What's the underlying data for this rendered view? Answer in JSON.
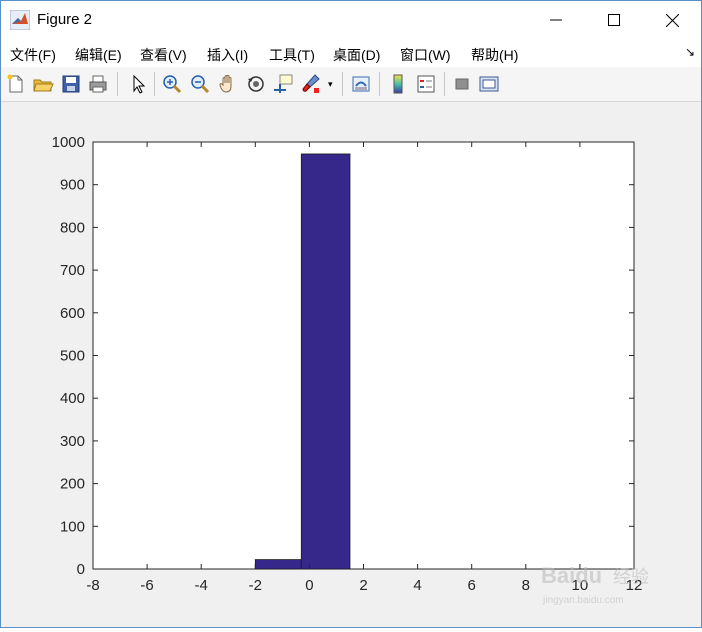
{
  "window": {
    "title": "Figure 2"
  },
  "menu": {
    "items": [
      "文件(F)",
      "编辑(E)",
      "查看(V)",
      "插入(I)",
      "工具(T)",
      "桌面(D)",
      "窗口(W)",
      "帮助(H)"
    ]
  },
  "toolbar": {
    "icons": [
      "new-figure-icon",
      "open-file-icon",
      "save-icon",
      "print-icon",
      "pointer-icon",
      "zoom-in-icon",
      "zoom-out-icon",
      "pan-icon",
      "rotate-3d-icon",
      "data-cursor-icon",
      "brush-icon",
      "link-plot-icon",
      "colorbar-icon",
      "legend-icon",
      "hide-plot-tools-icon",
      "show-plot-tools-icon"
    ]
  },
  "colors": {
    "bar": "#35288a",
    "axes_bg": "#ffffff",
    "figure_bg": "#f0f0f0"
  },
  "chart_data": {
    "type": "bar",
    "bins": [
      {
        "x_start": -2,
        "x_end": -0.3,
        "value": 22
      },
      {
        "x_start": -0.3,
        "x_end": 1.5,
        "value": 972
      }
    ],
    "xlim": [
      -8,
      12
    ],
    "ylim": [
      0,
      1000
    ],
    "xticks": [
      "-8",
      "-6",
      "-4",
      "-2",
      "0",
      "2",
      "4",
      "6",
      "8",
      "10",
      "12"
    ],
    "yticks": [
      "0",
      "100",
      "200",
      "300",
      "400",
      "500",
      "600",
      "700",
      "800",
      "900",
      "1000"
    ],
    "title": "",
    "xlabel": "",
    "ylabel": "",
    "grid": false
  },
  "watermark": {
    "brand": "Baidu",
    "text": "经验",
    "url": "jingyan.baidu.com"
  }
}
